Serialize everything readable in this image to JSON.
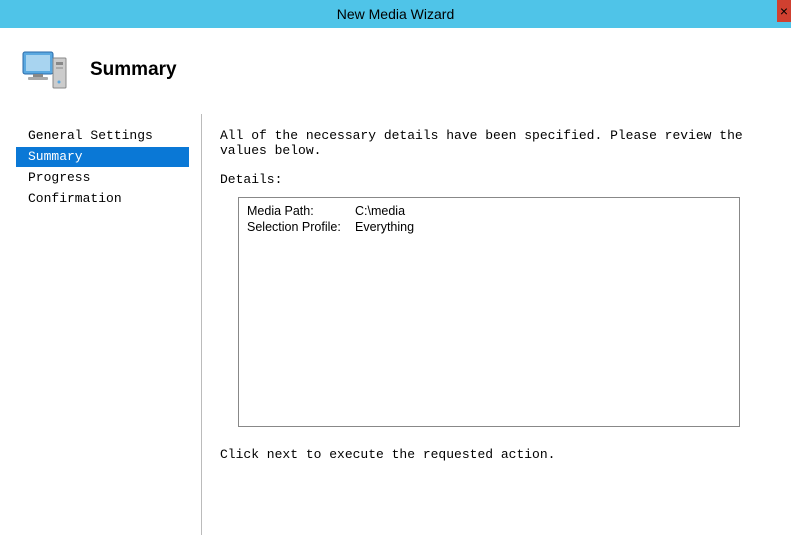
{
  "window": {
    "title": "New Media Wizard",
    "close_label": "×"
  },
  "header": {
    "title": "Summary"
  },
  "sidebar": {
    "items": [
      {
        "label": "General Settings",
        "selected": false
      },
      {
        "label": "Summary",
        "selected": true
      },
      {
        "label": "Progress",
        "selected": false
      },
      {
        "label": "Confirmation",
        "selected": false
      }
    ]
  },
  "main": {
    "instruction": "All of the necessary details have been specified.  Please review the values below.",
    "details_label": "Details:",
    "details": [
      {
        "key": "Media Path:",
        "value": "C:\\media"
      },
      {
        "key": "Selection Profile:",
        "value": "Everything"
      }
    ],
    "footer_text": "Click next to execute the requested action."
  }
}
